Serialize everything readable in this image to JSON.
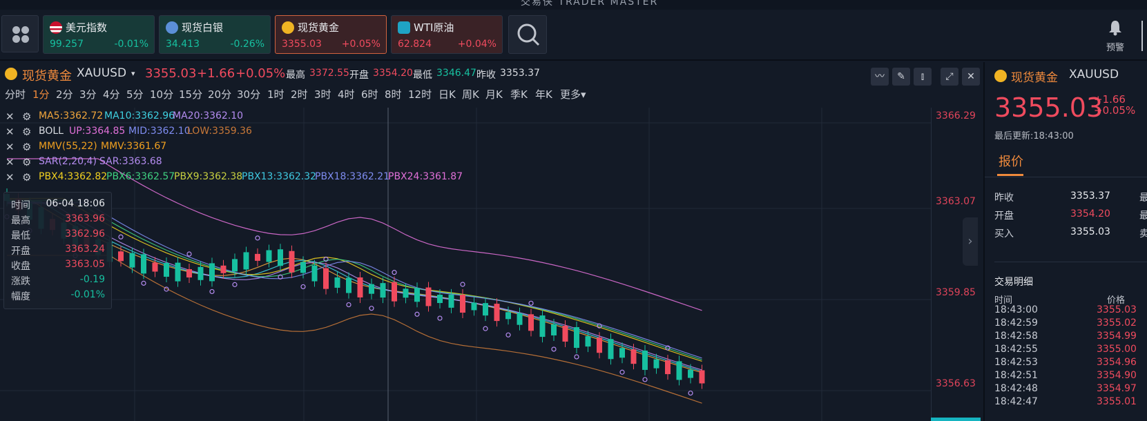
{
  "app_title": "交易侠 TRADER MASTER",
  "colors": {
    "up": "#f04b5e",
    "down": "#17c0a0",
    "accent": "#f08a3c",
    "bg": "#131a26"
  },
  "quotes": [
    {
      "name": "美元指数",
      "price": "99.257",
      "change": "-0.01%",
      "icon": "us-flag-icon",
      "trend": "down"
    },
    {
      "name": "现货白银",
      "price": "34.413",
      "change": "-0.26%",
      "icon": "silver-icon",
      "trend": "down"
    },
    {
      "name": "现货黄金",
      "price": "3355.03",
      "change": "+0.05%",
      "icon": "gold-icon",
      "trend": "up"
    },
    {
      "name": "WTI原油",
      "price": "62.824",
      "change": "+0.04%",
      "icon": "oil-icon",
      "trend": "up"
    }
  ],
  "alert_label": "预警",
  "chart_header": {
    "name": "现货黄金",
    "symbol": "XAUUSD",
    "price": "3355.03",
    "change": "+1.66",
    "change_pct": "+0.05%",
    "high_label": "最高",
    "high": "3372.55",
    "open_label": "开盘",
    "open": "3354.20",
    "low_label": "最低",
    "low": "3346.47",
    "prev_label": "昨收",
    "prev": "3353.37"
  },
  "periods": [
    "分时",
    "1分",
    "2分",
    "3分",
    "4分",
    "5分",
    "10分",
    "15分",
    "20分",
    "30分",
    "1时",
    "2时",
    "3时",
    "4时",
    "6时",
    "8时",
    "12时",
    "日K",
    "周K",
    "月K",
    "季K",
    "年K",
    "更多"
  ],
  "active_period": "1分",
  "indicators": {
    "ma": [
      "MA5:3362.72",
      "MA10:3362.96",
      "MA20:3362.10"
    ],
    "boll_name": "BOLL",
    "boll": [
      "UP:3364.85",
      "MID:3362.10",
      "LOW:3359.36"
    ],
    "mmv": [
      "MMV(55,22)",
      "MMV:3361.67"
    ],
    "sar": [
      "SAR(2,20,4)",
      "SAR:3363.68"
    ],
    "pbx": [
      "PBX4:3362.82",
      "PBX6:3362.57",
      "PBX9:3362.38",
      "PBX13:3362.32",
      "PBX18:3362.21",
      "PBX24:3361.87"
    ]
  },
  "price_axis": [
    "3366.29",
    "3363.07",
    "3359.85",
    "3356.63"
  ],
  "tooltip": {
    "time_label": "时间",
    "time": "06-04 18:06",
    "high_label": "最高",
    "high": "3363.96",
    "low_label": "最低",
    "low": "3362.96",
    "open_label": "开盘",
    "open": "3363.24",
    "close_label": "收盘",
    "close": "3363.05",
    "chg_label": "涨跌",
    "chg": "-0.19",
    "amp_label": "幅度",
    "amp": "-0.01%"
  },
  "side": {
    "name": "现货黄金",
    "symbol": "XAUUSD",
    "price": "3355.03",
    "change": "+1.66",
    "change_pct": "+0.05%",
    "updated": "最后更新:18:43:00",
    "tab": "报价",
    "quote_rows": [
      {
        "label": "昨收",
        "value": "3353.37",
        "trend": "flat",
        "stub": "最"
      },
      {
        "label": "开盘",
        "value": "3354.20",
        "trend": "up",
        "stub": "最"
      },
      {
        "label": "买入",
        "value": "3355.03",
        "trend": "flat",
        "stub": "卖"
      }
    ],
    "detail_title": "交易明细",
    "col_time": "时间",
    "col_price": "价格",
    "trades": [
      {
        "time": "18:43:00",
        "price": "3355.03"
      },
      {
        "time": "18:42:59",
        "price": "3355.02"
      },
      {
        "time": "18:42:58",
        "price": "3354.99"
      },
      {
        "time": "18:42:55",
        "price": "3355.00"
      },
      {
        "time": "18:42:53",
        "price": "3354.96"
      },
      {
        "time": "18:42:51",
        "price": "3354.90"
      },
      {
        "time": "18:42:48",
        "price": "3354.97"
      },
      {
        "time": "18:42:47",
        "price": "3355.01"
      }
    ]
  }
}
